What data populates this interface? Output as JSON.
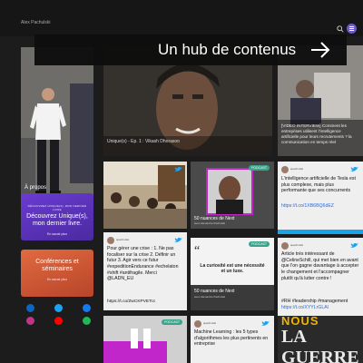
{
  "header": {
    "site_name": "Alex Pachulski",
    "search_icon": "search-icon",
    "menu_icon": "menu-icon"
  },
  "hero": {
    "title": "Un hub de contenus",
    "arrow_icon": "arrow-right-icon"
  },
  "sidebar": {
    "about_label": "À propos",
    "promo_book": {
      "small": "DÉCOUVREZ UNIQUE(S), MON DERNIER LIVRE",
      "title": "Découvrez Unique(s), mon dernier livre.",
      "more": "En savoir plus"
    },
    "promo_talks": {
      "title": "Conférences et séminaires",
      "more": "En savoir plus"
    },
    "socials": [
      "linkedin-icon",
      "twitter-icon",
      "facebook-icon",
      "instagram-icon",
      "youtube-icon",
      "spotify-icon"
    ],
    "colors": {
      "linkedin": "#0a66c2",
      "twitter": "#1da1f2",
      "facebook": "#1877f2",
      "instagram": "#c13584",
      "youtube": "#ff0000",
      "spotify": "#1db954"
    }
  },
  "cards": {
    "video": {
      "caption": "Unique(s) - Ep. 1 : Vikash Dhorasoo"
    },
    "news_top": {
      "text": "[VIDEO INTERVIEW] Comment les entreprises utilisent l'intelligence artificielle pour leurs recrutements ? la communication en temps réel"
    },
    "meetup": {
      "title": "50 nuances de Next"
    },
    "tweet1": {
      "author": "apachulski",
      "text": "Pour gérer une crise : 1. Ne pas focaliser sur la crise 2. Définir un futur 3. Agir vers ce futur #expeditionEndurance #echelaton #shift #antifragile. Merci @LADN_EU",
      "link": "https://t.co/ZwCKPVETcc"
    },
    "podcast1": {
      "badge": "PODCAST",
      "title": "50 nuances de Next",
      "subtitle": "avec Alexandre Pachulski"
    },
    "tweet_ai": {
      "author": "apachulski",
      "text": "L'intelligence artificielle de Tesla est plus complexe, mais plus performante que ses concurrents",
      "link": "https://t.co/1XB6BQ6dEZ"
    },
    "quote": {
      "badge": "PODCAST",
      "text": "La curiosité est une nécessité et un luxe.",
      "title": "50 nuances de Next",
      "subtitle": "avec Alexandre Pachulski"
    },
    "tweet2": {
      "author": "apachulski",
      "text": "Article très intéressant de @CelineSchill, qui met bien en avant que l'on gagne davantage à accepter le changement et l'accompagner plutôt qu'à lutter contre !",
      "hashtags": "#RH #leadership #management",
      "link": "https://t.co/XYYLrGLAl"
    },
    "podcast2": {
      "badge": "PODCAST"
    },
    "tweet3": {
      "author": "apachulski",
      "text": "Machine Learning : les 5 types d'algorithmes les plus pertinents en entreprise"
    },
    "book": {
      "line1": "NOUS",
      "line2": "LA GUERRE"
    }
  }
}
